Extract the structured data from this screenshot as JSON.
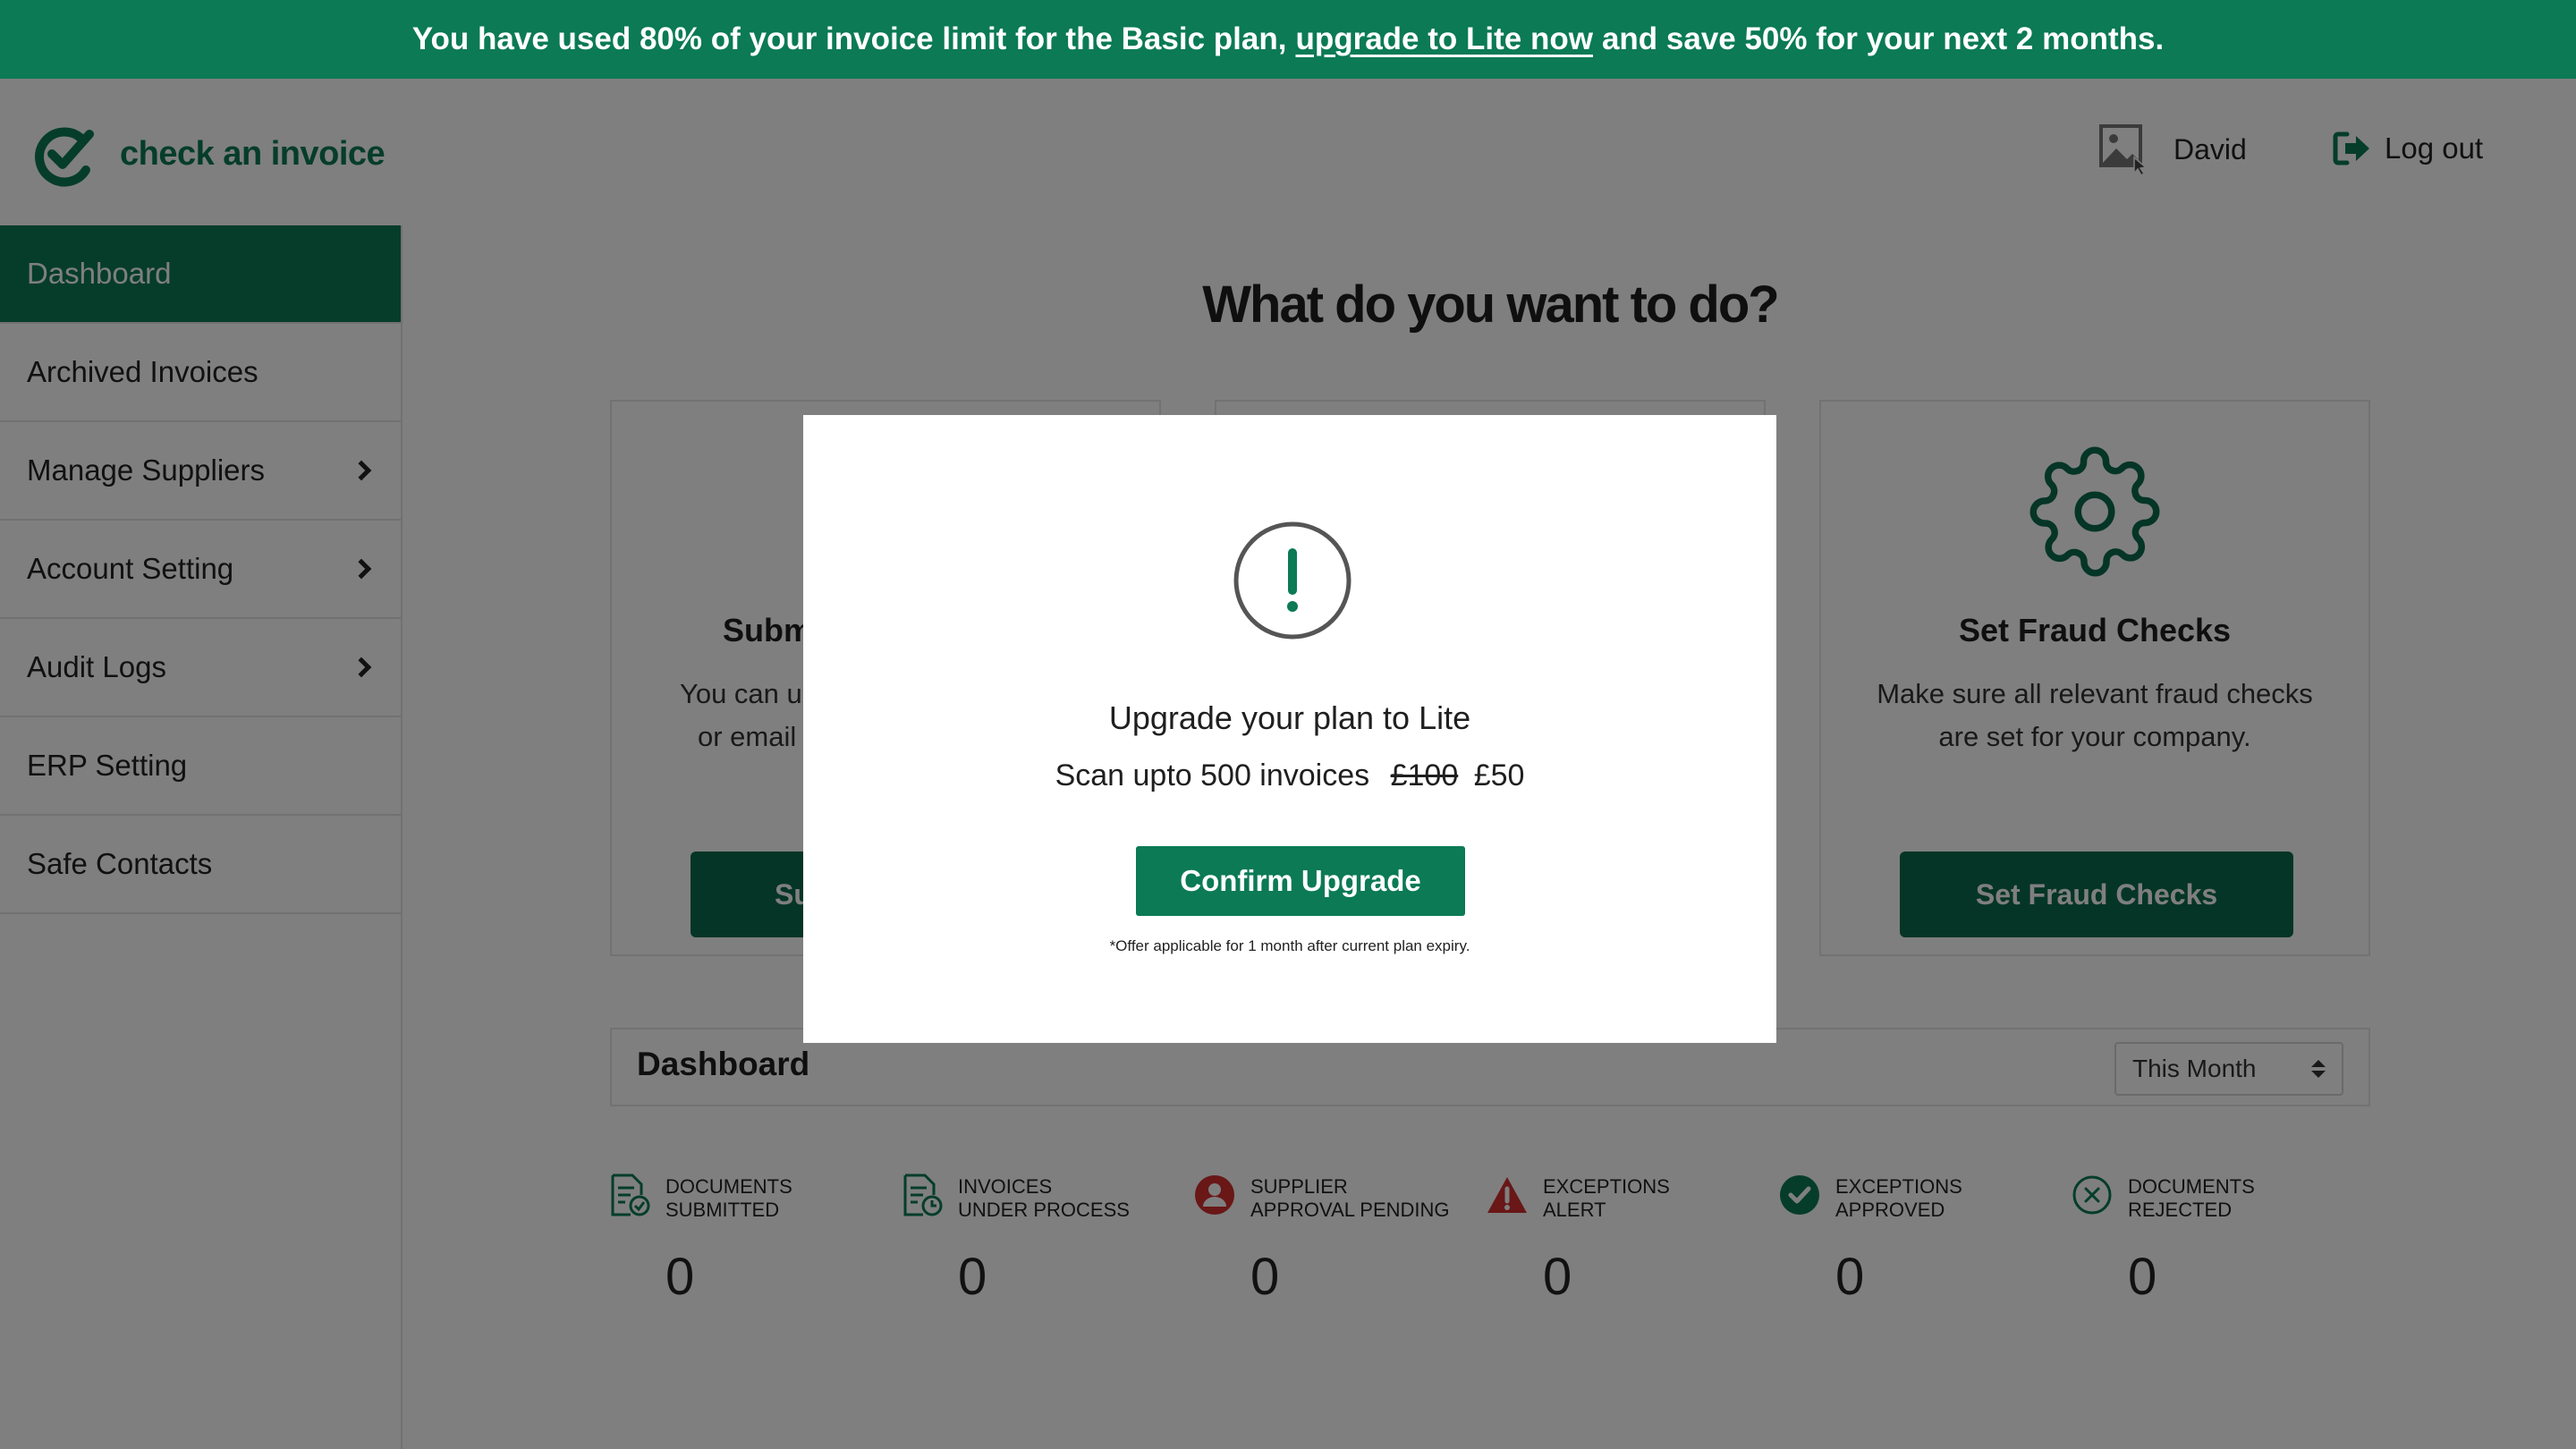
{
  "banner": {
    "text_before": "You have used 80% of your invoice limit for the Basic plan,",
    "link": "upgrade to Lite now",
    "text_after": "and save 50% for your next 2 months."
  },
  "header": {
    "logo_text": "check an invoice",
    "user_name": "David",
    "logout_label": "Log out"
  },
  "sidebar": {
    "items": [
      {
        "label": "Dashboard",
        "active": true,
        "has_submenu": false
      },
      {
        "label": "Archived Invoices",
        "active": false,
        "has_submenu": false
      },
      {
        "label": "Manage Suppliers",
        "active": false,
        "has_submenu": true
      },
      {
        "label": "Account Setting",
        "active": false,
        "has_submenu": true
      },
      {
        "label": "Audit Logs",
        "active": false,
        "has_submenu": true
      },
      {
        "label": "ERP Setting",
        "active": false,
        "has_submenu": false
      },
      {
        "label": "Safe Contacts",
        "active": false,
        "has_submenu": false
      }
    ]
  },
  "main": {
    "title": "What do you want to do?",
    "cards": [
      {
        "title": "Subm",
        "desc_line1": "You can u",
        "desc_line2": "or email",
        "button": "Su"
      },
      {
        "title": "",
        "desc_line1": "",
        "desc_line2": "",
        "button": ""
      },
      {
        "title": "Set Fraud Checks",
        "desc_line1": "Make sure all relevant fraud checks",
        "desc_line2": "are set for your company.",
        "button": "Set Fraud Checks",
        "icon": "gear-icon"
      }
    ],
    "dashboard": {
      "title": "Dashboard",
      "period": "This Month",
      "stats": [
        {
          "line1": "Documents",
          "line2": "Submitted",
          "value": "0",
          "icon": "document-check-icon",
          "color": "#0b7a55"
        },
        {
          "line1": "Invoices",
          "line2": "Under Process",
          "value": "0",
          "icon": "document-clock-icon",
          "color": "#0b7a55"
        },
        {
          "line1": "Supplier",
          "line2": "Approval Pending",
          "value": "0",
          "icon": "user-pending-icon",
          "color": "#d32f2f"
        },
        {
          "line1": "Exceptions",
          "line2": "Alert",
          "value": "0",
          "icon": "warning-icon",
          "color": "#d32f2f"
        },
        {
          "line1": "Exceptions",
          "line2": "Approved",
          "value": "0",
          "icon": "check-circle-icon",
          "color": "#0b7a55"
        },
        {
          "line1": "Documents",
          "line2": "Rejected",
          "value": "0",
          "icon": "x-circle-icon",
          "color": "#0b7a55"
        }
      ]
    }
  },
  "modal": {
    "icon": "exclamation-icon",
    "title": "Upgrade your plan to Lite",
    "price_text": "Scan upto 500 invoices",
    "old_price": "£100",
    "new_price": "£50",
    "button": "Confirm Upgrade",
    "note": "*Offer applicable for 1 month after current plan expiry."
  },
  "colors": {
    "brand": "#0b7a55",
    "brand_dark": "#0b6a4c",
    "alert": "#d32f2f"
  }
}
